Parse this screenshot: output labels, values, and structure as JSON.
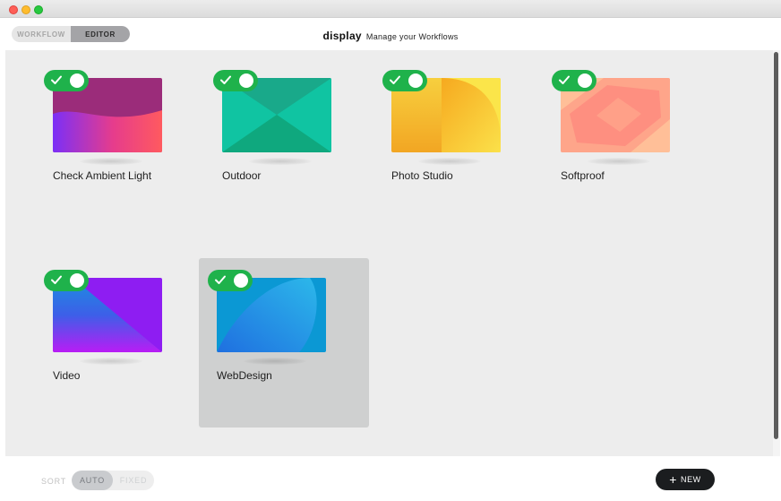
{
  "window": {
    "controls": [
      "close",
      "minimize",
      "zoom"
    ]
  },
  "header": {
    "mode_tabs": [
      {
        "label": "WORKFLOW",
        "selected": false
      },
      {
        "label": "EDITOR",
        "selected": true
      }
    ],
    "app_name": "display",
    "tagline": "Manage your Workflows"
  },
  "workflows": [
    {
      "name": "Check Ambient Light",
      "enabled": true,
      "selected": false,
      "thumbnail": "magenta-wave",
      "colors": [
        "#9b2c7a",
        "#7b2ff7",
        "#ff5a5f"
      ]
    },
    {
      "name": "Outdoor",
      "enabled": true,
      "selected": false,
      "thumbnail": "teal-envelope",
      "colors": [
        "#14b08a",
        "#10c9a0",
        "#0fa87e"
      ]
    },
    {
      "name": "Photo Studio",
      "enabled": true,
      "selected": false,
      "thumbnail": "yellow-arc",
      "colors": [
        "#f7c341",
        "#f2a623",
        "#fbe14a"
      ]
    },
    {
      "name": "Softproof",
      "enabled": true,
      "selected": false,
      "thumbnail": "peach-diamond",
      "colors": [
        "#ffb08c",
        "#fe8f80",
        "#ffc69a"
      ]
    },
    {
      "name": "Video",
      "enabled": true,
      "selected": false,
      "thumbnail": "violet-diagonal",
      "colors": [
        "#8e1df2",
        "#1b7be0",
        "#b91cf5"
      ]
    },
    {
      "name": "WebDesign",
      "enabled": true,
      "selected": true,
      "thumbnail": "blue-leaf",
      "colors": [
        "#0a9ad6",
        "#1f7ddf",
        "#25b4e8"
      ]
    }
  ],
  "footer": {
    "sort_label": "SORT",
    "sort_options": [
      {
        "label": "AUTO",
        "selected": true
      },
      {
        "label": "FIXED",
        "selected": false
      }
    ],
    "new_button": {
      "icon": "plus-icon",
      "label": "NEW"
    }
  }
}
